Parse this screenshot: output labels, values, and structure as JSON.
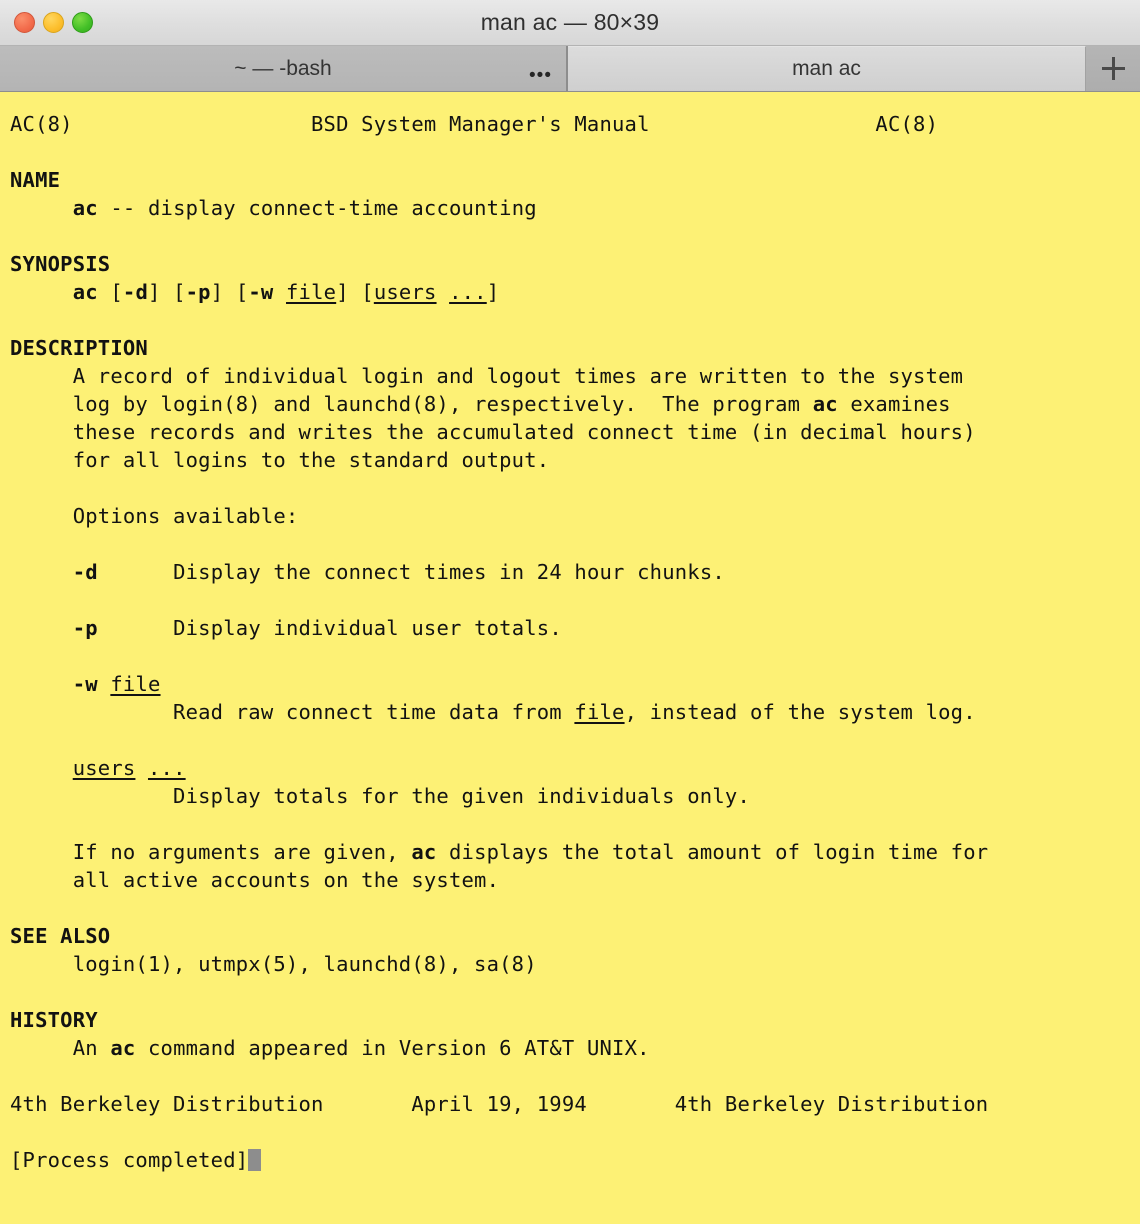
{
  "window": {
    "title": "man ac — 80×39",
    "traffic_lights": [
      {
        "name": "close",
        "color": "#f26b4b"
      },
      {
        "name": "minimize",
        "color": "#fcbe2c"
      },
      {
        "name": "maximize",
        "color": "#42bf27"
      }
    ]
  },
  "tabs": [
    {
      "label": "~ — -bash",
      "active": false,
      "overflow_indicator": "•••"
    },
    {
      "label": "man ac",
      "active": true,
      "overflow_indicator": ""
    }
  ],
  "new_tab_button": {
    "icon": "plus-icon",
    "label": "+"
  },
  "terminal": {
    "background_color": "#fdf175",
    "foreground_color": "#121212",
    "cursor_color": "#8d8d8d",
    "size": "80×39",
    "header": {
      "left": "AC(8)",
      "center": "BSD System Manager's Manual",
      "right": "AC(8)"
    },
    "sections": [
      {
        "heading": "NAME",
        "lines": [
          "    <b>ac</b> -- display connect-time accounting"
        ]
      },
      {
        "heading": "SYNOPSIS",
        "lines": [
          "    <b>ac</b> [<b>-d</b>] [<b>-p</b>] [<b>-w</b> <u>file</u>] [<u>users</u> <u>...</u>]"
        ]
      },
      {
        "heading": "DESCRIPTION",
        "lines": [
          "    A record of individual login and logout times are written to the system",
          "    log by login(8) and launchd(8), respectively.  The program <b>ac</b> examines",
          "    these records and writes the accumulated connect time (in decimal hours)",
          "    for all logins to the standard output.",
          "",
          "    Options available:",
          "",
          "    <b>-d</b>      Display the connect times in 24 hour chunks.",
          "",
          "    <b>-p</b>      Display individual user totals.",
          "",
          "    <b>-w</b> <u>file</u>",
          "            Read raw connect time data from <u>file</u>, instead of the system log.",
          "",
          "    <u>users</u> <u>...</u>",
          "            Display totals for the given individuals only.",
          "",
          "    If no arguments are given, <b>ac</b> displays the total amount of login time for",
          "    all active accounts on the system."
        ]
      },
      {
        "heading": "SEE ALSO",
        "lines": [
          "    login(1), utmpx(5), launchd(8), sa(8)"
        ]
      },
      {
        "heading": "HISTORY",
        "lines": [
          "    An <b>ac</b> command appeared in Version 6 AT&amp;T UNIX."
        ]
      }
    ],
    "footer": {
      "left": "4th Berkeley Distribution",
      "center": "April 19, 1994",
      "right": "4th Berkeley Distribution"
    },
    "status_line": "[Process completed]",
    "manpage_body": "AC(8)                   BSD System Manager's Manual                  AC(8)\n\n<b>NAME</b>\n     <b>ac</b> -- display connect-time accounting\n\n<b>SYNOPSIS</b>\n     <b>ac</b> [<b>-d</b>] [<b>-p</b>] [<b>-w</b> <u>file</u>] [<u>users</u> <u>...</u>]\n\n<b>DESCRIPTION</b>\n     A record of individual login and logout times are written to the system\n     log by login(8) and launchd(8), respectively.  The program <b>ac</b> examines\n     these records and writes the accumulated connect time (in decimal hours)\n     for all logins to the standard output.\n\n     Options available:\n\n     <b>-d</b>      Display the connect times in 24 hour chunks.\n\n     <b>-p</b>      Display individual user totals.\n\n     <b>-w</b> <u>file</u>\n             Read raw connect time data from <u>file</u>, instead of the system log.\n\n     <u>users</u> <u>...</u>\n             Display totals for the given individuals only.\n\n     If no arguments are given, <b>ac</b> displays the total amount of login time for\n     all active accounts on the system.\n\n<b>SEE ALSO</b>\n     login(1), utmpx(5), launchd(8), sa(8)\n\n<b>HISTORY</b>\n     An <b>ac</b> command appeared in Version 6 AT&amp;T UNIX.\n\n4th Berkeley Distribution       April 19, 1994       4th Berkeley Distribution\n\n[Process completed]"
  }
}
